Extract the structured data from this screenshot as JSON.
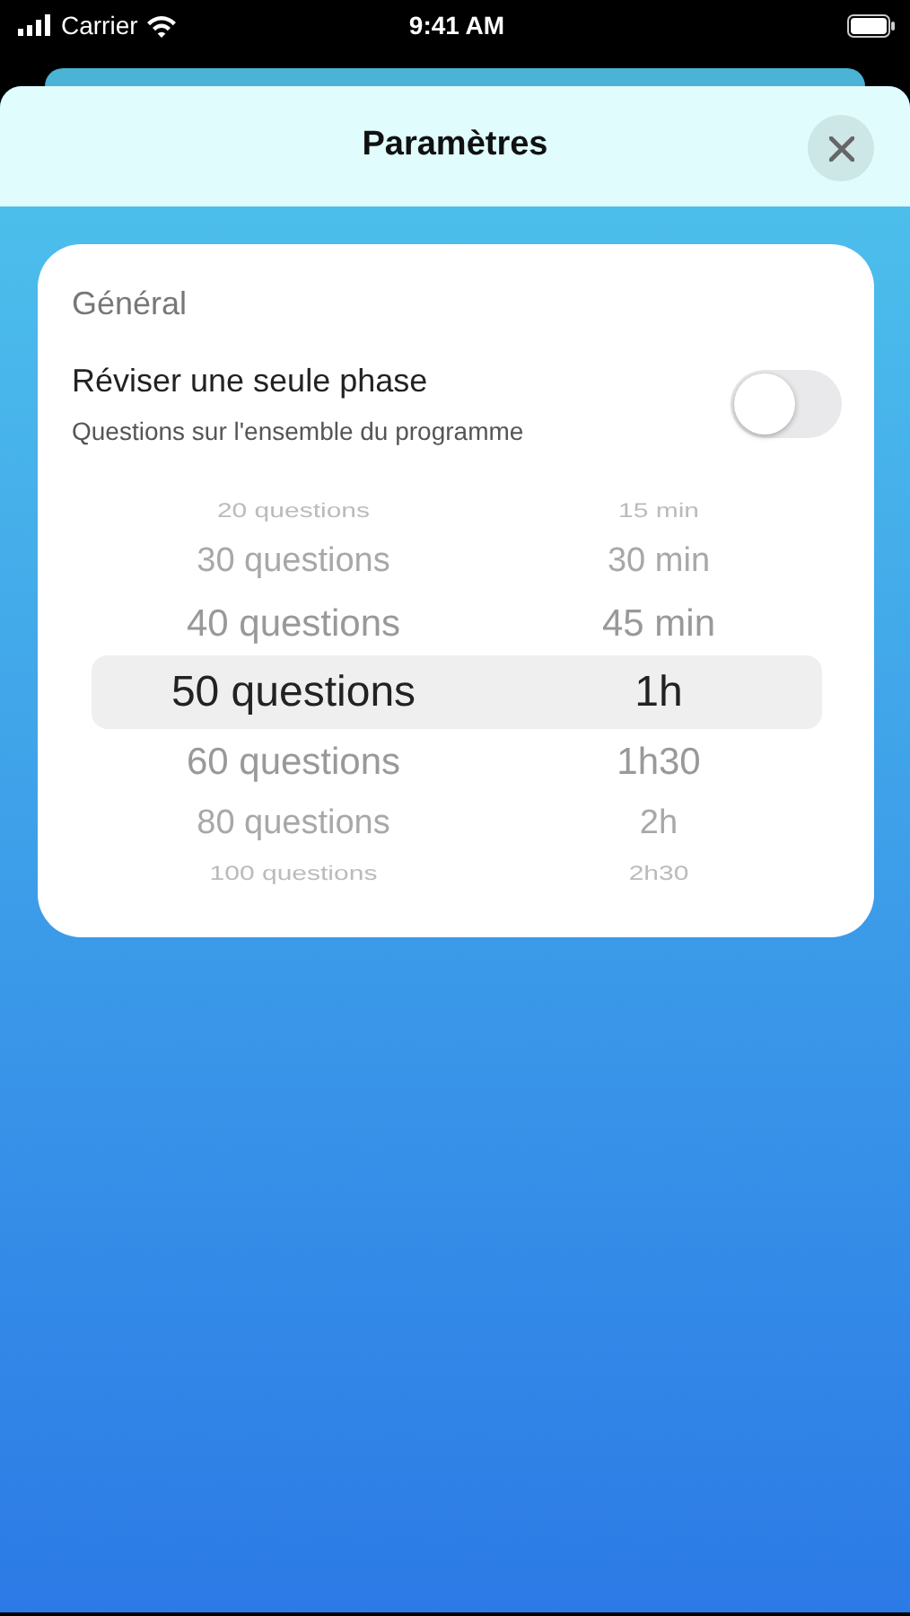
{
  "status_bar": {
    "carrier": "Carrier",
    "time": "9:41 AM"
  },
  "sheet": {
    "title": "Paramètres"
  },
  "card": {
    "section_title": "Général",
    "toggle": {
      "label": "Réviser une seule phase",
      "sublabel": "Questions sur l'ensemble du programme",
      "on": false
    },
    "picker": [
      {
        "questions": "20 questions",
        "duration": "15 min",
        "selected": false
      },
      {
        "questions": "30 questions",
        "duration": "30 min",
        "selected": false
      },
      {
        "questions": "40 questions",
        "duration": "45 min",
        "selected": false
      },
      {
        "questions": "50 questions",
        "duration": "1h",
        "selected": true
      },
      {
        "questions": "60 questions",
        "duration": "1h30",
        "selected": false
      },
      {
        "questions": "80 questions",
        "duration": "2h",
        "selected": false
      },
      {
        "questions": "100 questions",
        "duration": "2h30",
        "selected": false
      }
    ]
  }
}
